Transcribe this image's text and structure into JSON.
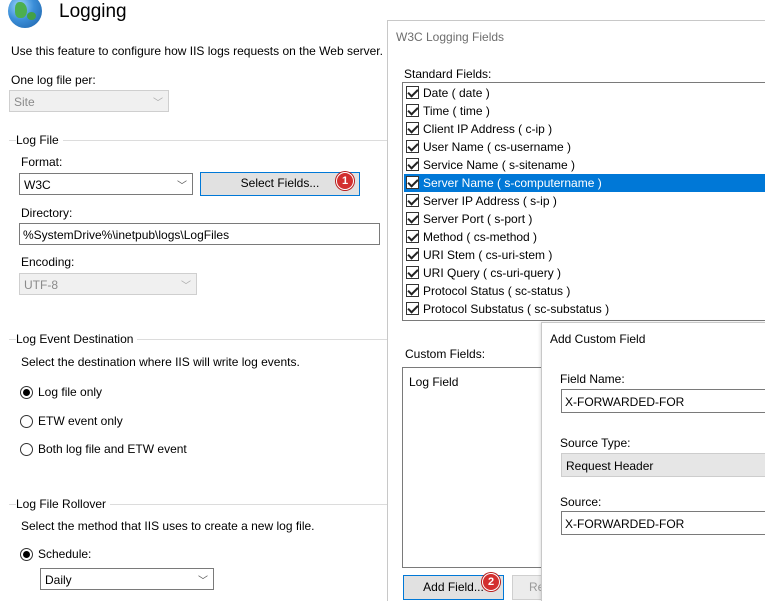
{
  "page": {
    "title": "Logging",
    "description": "Use this feature to configure how IIS logs requests on the Web server.",
    "one_log_file_per_label": "One log file per:",
    "one_log_file_per_value": "Site"
  },
  "log_file": {
    "group_label": "Log File",
    "format_label": "Format:",
    "format_value": "W3C",
    "select_fields_label": "Select Fields...",
    "directory_label": "Directory:",
    "directory_value": "%SystemDrive%\\inetpub\\logs\\LogFiles",
    "encoding_label": "Encoding:",
    "encoding_value": "UTF-8"
  },
  "log_event_destination": {
    "group_label": "Log Event Destination",
    "description": "Select the destination where IIS will write log events.",
    "options": [
      {
        "label": "Log file only",
        "selected": true
      },
      {
        "label": "ETW event only",
        "selected": false
      },
      {
        "label": "Both log file and ETW event",
        "selected": false
      }
    ]
  },
  "log_file_rollover": {
    "group_label": "Log File Rollover",
    "description": "Select the method that IIS uses to create a new log file.",
    "schedule_label": "Schedule:",
    "schedule_value": "Daily"
  },
  "badges": {
    "first": "1",
    "second": "2"
  },
  "w3c_dialog": {
    "title": "W3C Logging Fields",
    "standard_fields_label": "Standard Fields:",
    "fields": [
      {
        "label": "Date ( date )",
        "checked": true
      },
      {
        "label": "Time ( time )",
        "checked": true
      },
      {
        "label": "Client IP Address ( c-ip )",
        "checked": true
      },
      {
        "label": "User Name ( cs-username )",
        "checked": true
      },
      {
        "label": "Service Name ( s-sitename )",
        "checked": true
      },
      {
        "label": "Server Name ( s-computername )",
        "checked": true
      },
      {
        "label": "Server IP Address ( s-ip )",
        "checked": true
      },
      {
        "label": "Server Port ( s-port )",
        "checked": true
      },
      {
        "label": "Method ( cs-method )",
        "checked": true
      },
      {
        "label": "URI Stem ( cs-uri-stem )",
        "checked": true
      },
      {
        "label": "URI Query ( cs-uri-query )",
        "checked": true
      },
      {
        "label": "Protocol Status ( sc-status )",
        "checked": true
      },
      {
        "label": "Protocol Substatus ( sc-substatus )",
        "checked": true
      }
    ],
    "selected_field": "Server Name ( s-computername )",
    "custom_fields_label": "Custom Fields:",
    "custom_fields_header": "Log Field",
    "add_field_label": "Add Field...",
    "remove_label_partial": "Re"
  },
  "add_custom_field": {
    "title": "Add Custom Field",
    "field_name_label": "Field Name:",
    "field_name_value": "X-FORWARDED-FOR",
    "source_type_label": "Source Type:",
    "source_type_value": "Request Header",
    "source_label": "Source:",
    "source_value": "X-FORWARDED-FOR"
  },
  "colors": {
    "selection": "#0078d7",
    "badge": "#d32f2f"
  }
}
